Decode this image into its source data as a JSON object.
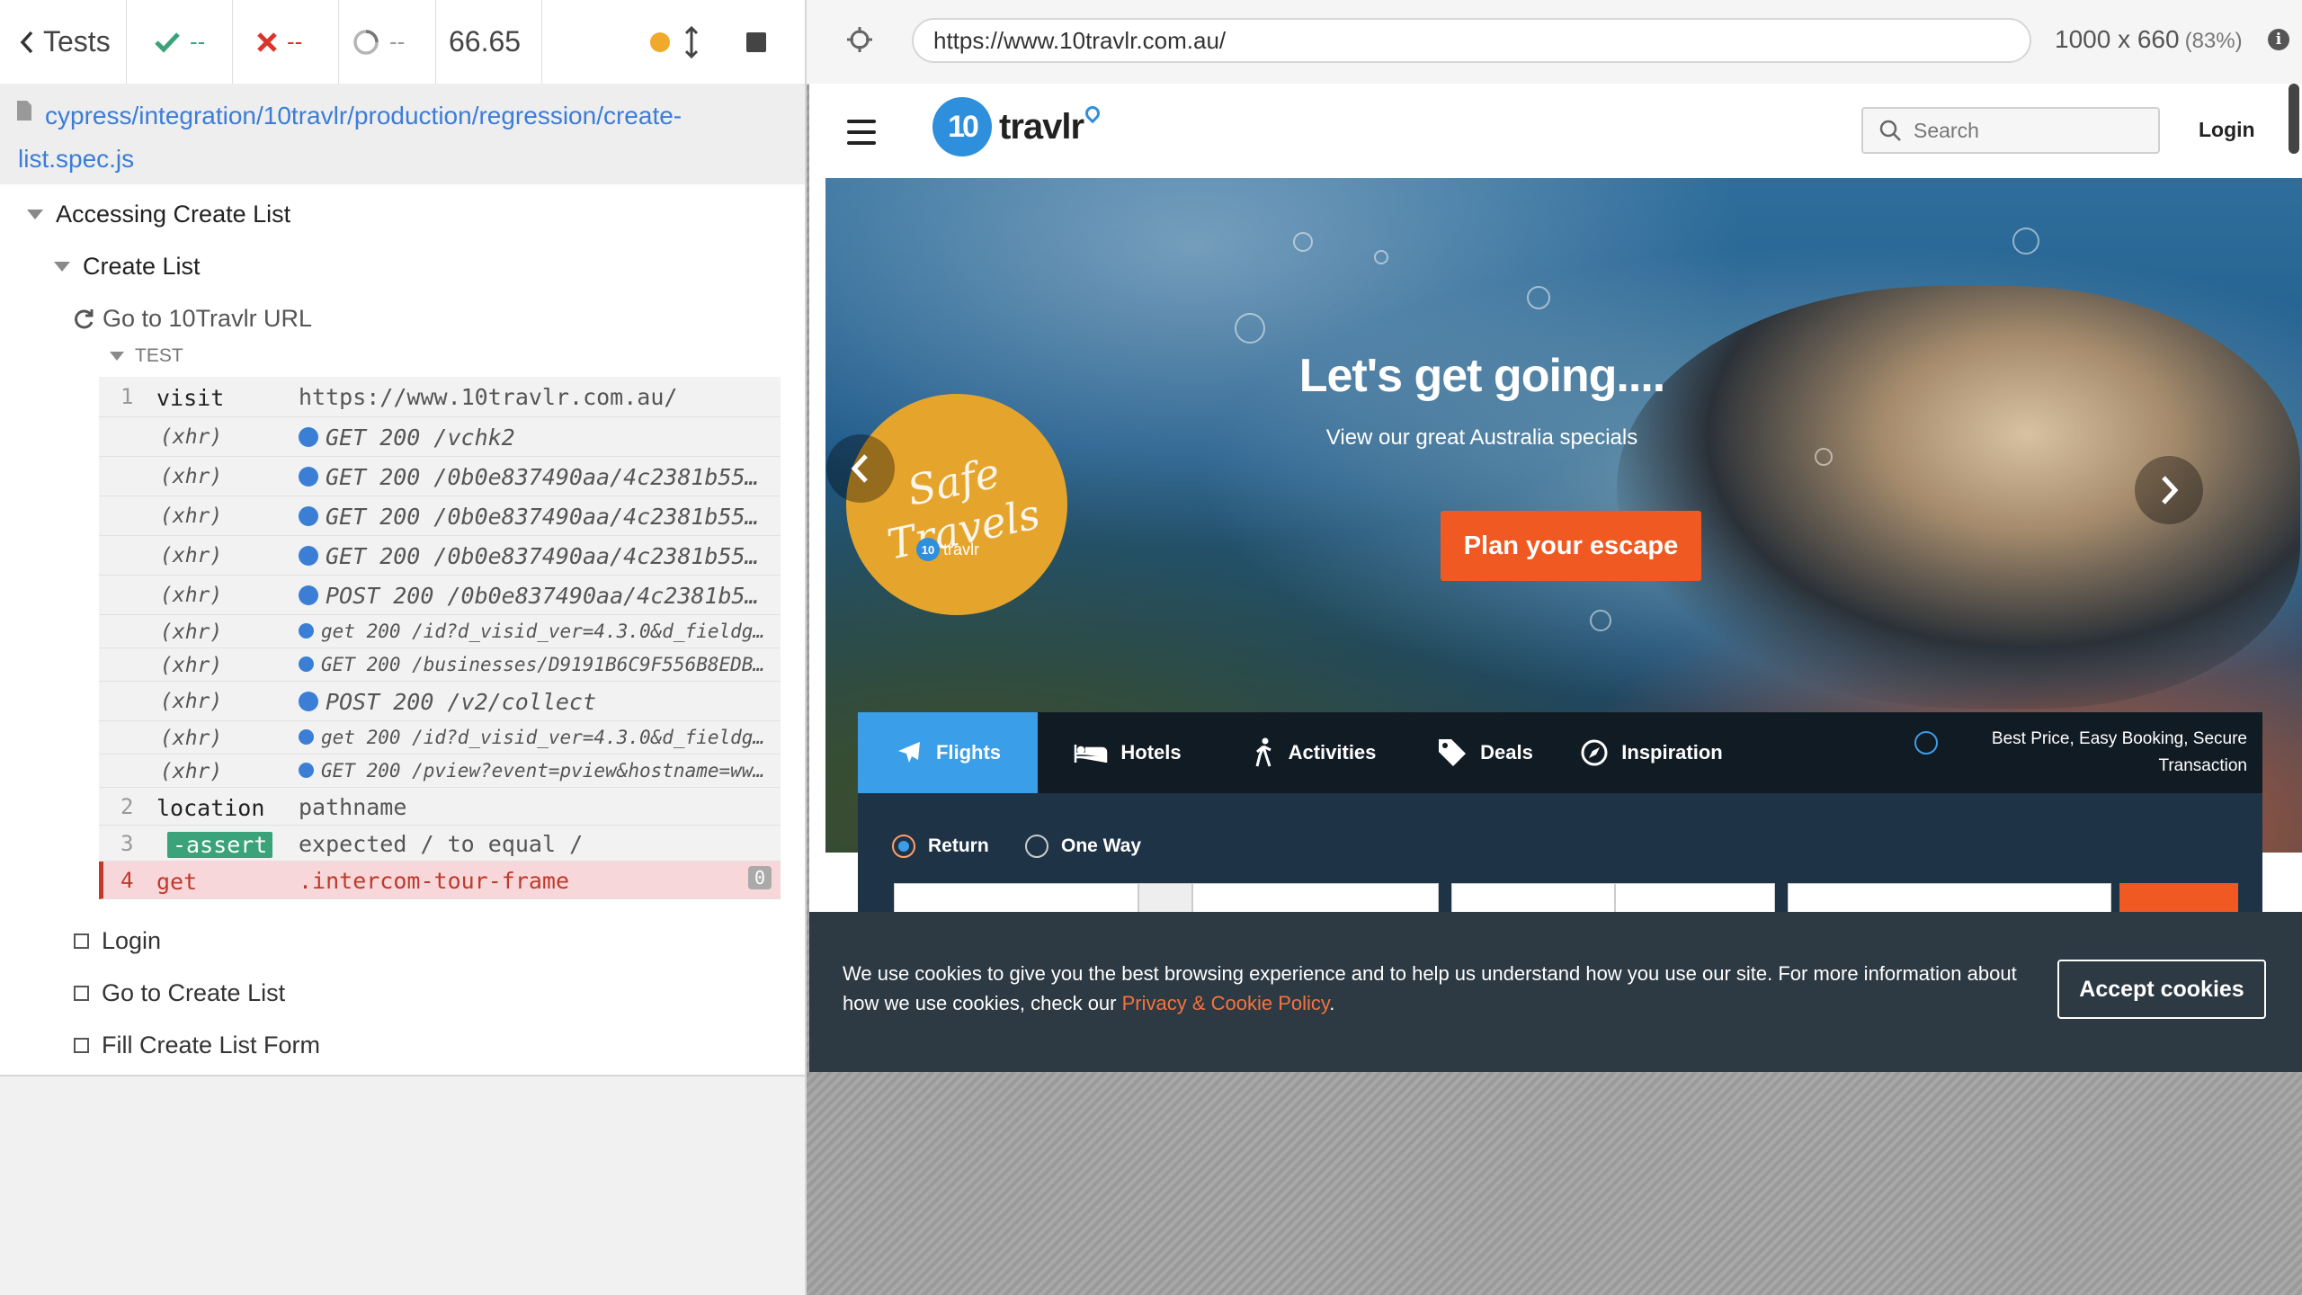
{
  "runner": {
    "header": {
      "back_label": "Tests",
      "passed": "--",
      "failed": "--",
      "pending": "--",
      "duration": "66.65"
    },
    "spec_path": "cypress/integration/10travlr/production/regression/create-list.spec.js",
    "suite": "Accessing Create List",
    "sub_suite": "Create List",
    "current_test": "Go to 10Travlr URL",
    "test_section": "TEST",
    "commands": [
      {
        "num": "1",
        "name": "visit",
        "message": "https://www.10travlr.com.au/"
      },
      {
        "num": "",
        "name": "(xhr)",
        "message": "GET 200 /vchk2"
      },
      {
        "num": "",
        "name": "(xhr)",
        "message": "GET 200 /0b0e837490aa/4c2381b551c..."
      },
      {
        "num": "",
        "name": "(xhr)",
        "message": "GET 200 /0b0e837490aa/4c2381b551c..."
      },
      {
        "num": "",
        "name": "(xhr)",
        "message": "GET 200 /0b0e837490aa/4c2381b551c..."
      },
      {
        "num": "",
        "name": "(xhr)",
        "message": "POST 200 /0b0e837490aa/4c2381b551..."
      },
      {
        "num": "",
        "name": "(xhr)",
        "message": "get 200 /id?d_visid_ver=4.3.0&d_fieldgr..."
      },
      {
        "num": "",
        "name": "(xhr)",
        "message": "GET 200 /businesses/D9191B6C9F556B8EDB9..."
      },
      {
        "num": "",
        "name": "(xhr)",
        "message": "POST 200 /v2/collect"
      },
      {
        "num": "",
        "name": "(xhr)",
        "message": "get 200 /id?d_visid_ver=4.3.0&d_fieldgr..."
      },
      {
        "num": "",
        "name": "(xhr)",
        "message": "GET 200 /pview?event=pview&hostname=www..."
      },
      {
        "num": "2",
        "name": "location",
        "message": "pathname"
      },
      {
        "num": "3",
        "name": "-assert",
        "expected": "expected",
        "slash1": "/",
        "to_equal": "to equal",
        "slash2": "/"
      },
      {
        "num": "4",
        "name": "get",
        "message": ".intercom-tour-frame",
        "badge": "0"
      }
    ],
    "pending_tests": [
      "Login",
      "Go to Create List",
      "Fill Create List Form"
    ]
  },
  "browser": {
    "url": "https://www.10travlr.com.au/",
    "viewport": "1000 x 660",
    "scale": "(83%)"
  },
  "site": {
    "logo_mark": "10",
    "logo_text": "travlr",
    "search_placeholder": "Search",
    "login_label": "Login",
    "hero": {
      "title": "Let's get going....",
      "subtitle": "View our great Australia specials",
      "cta": "Plan your escape",
      "badge_script": "Safe Travels",
      "badge_mark": "10",
      "badge_brand": "travlr"
    },
    "tabs": [
      "Flights",
      "Hotels",
      "Activities",
      "Deals",
      "Inspiration"
    ],
    "best_price": "Best Price, Easy Booking, Secure Transaction",
    "trip_types": [
      "Return",
      "One Way"
    ]
  },
  "cookie": {
    "text": "We use cookies to give you the best browsing experience and to help us understand how you use our site. For more information about how we use cookies, check our ",
    "link": "Privacy & Cookie Policy",
    "period": ".",
    "button": "Accept cookies"
  },
  "colors": {
    "passed": "#3aa37a",
    "failed": "#d9342b",
    "running": "#f0a92a",
    "accent": "#f05a22",
    "brand": "#2e8fdc"
  }
}
